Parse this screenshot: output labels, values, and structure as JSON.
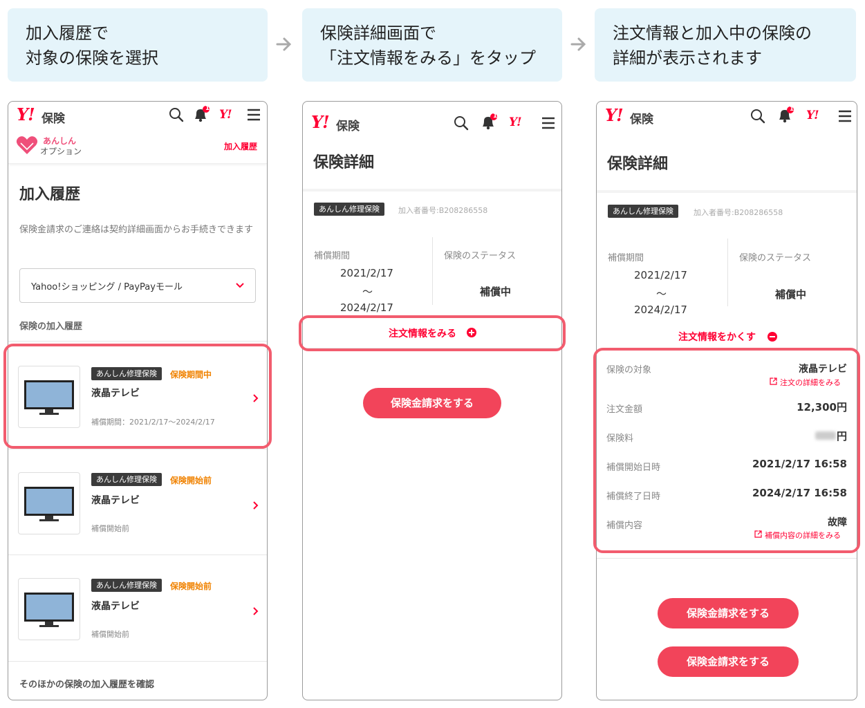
{
  "steps": [
    {
      "line1": "加入履歴で",
      "line2": "対象の保険を選択"
    },
    {
      "line1": "保険詳細画面で",
      "line2": "「注文情報をみる」をタップ"
    },
    {
      "line1": "注文情報と加入中の保険の",
      "line2": "詳細が表示されます"
    }
  ],
  "header": {
    "logo": "Y!",
    "logo_sub": "保険",
    "notification_count": "1",
    "yahoo_mark": "Y!"
  },
  "screen1": {
    "brand_line1": "あんしん",
    "brand_line2": "オプション",
    "history_link": "加入履歴",
    "title": "加入履歴",
    "description": "保険金請求のご連絡は契約詳細画面からお手続きできます",
    "select_value": "Yahoo!ショッピング / PayPayモール",
    "section_label": "保険の加入履歴",
    "items": [
      {
        "badge": "あんしん修理保険",
        "status": "保険期間中",
        "name": "液晶テレビ",
        "sub": "補償期間：2021/2/17〜2024/2/17"
      },
      {
        "badge": "あんしん修理保険",
        "status": "保険開始前",
        "name": "液晶テレビ",
        "sub": "補償開始前"
      },
      {
        "badge": "あんしん修理保険",
        "status": "保険開始前",
        "name": "液晶テレビ",
        "sub": "補償開始前"
      }
    ],
    "footer_link": "そのほかの保険の加入履歴を確認"
  },
  "screen2": {
    "title": "保険詳細",
    "badge": "あんしん修理保険",
    "member_no": "加入者番号:B208286558",
    "period_label": "補償期間",
    "period_start": "2021/2/17",
    "period_tilde": "〜",
    "period_end": "2024/2/17",
    "status_label": "保険のステータス",
    "status_value": "補償中",
    "toggle_link": "注文情報をみる",
    "claim_button": "保険金請求をする"
  },
  "screen3": {
    "title": "保険詳細",
    "badge": "あんしん修理保険",
    "member_no": "加入者番号:B208286558",
    "period_label": "補償期間",
    "period_start": "2021/2/17",
    "period_tilde": "〜",
    "period_end": "2024/2/17",
    "status_label": "保険のステータス",
    "status_value": "補償中",
    "toggle_link": "注文情報をかくす",
    "rows": [
      {
        "label": "保険の対象",
        "value": "液晶テレビ",
        "link": "注文の詳細をみる"
      },
      {
        "label": "注文金額",
        "value": "12,300円"
      },
      {
        "label": "保険料",
        "value": "円"
      },
      {
        "label": "補償開始日時",
        "value": "2021/2/17 16:58"
      },
      {
        "label": "補償終了日時",
        "value": "2024/2/17 16:58"
      },
      {
        "label": "補償内容",
        "value": "故障",
        "link": "補償内容の詳細をみる"
      }
    ],
    "claim_button_1": "保険金請求をする",
    "claim_button_2": "保険金請求をする"
  },
  "colors": {
    "brand_red": "#ff0033",
    "highlight": "#f25c6e",
    "step_bg": "#e5f4fa",
    "status_orange": "#f08200",
    "button_pink": "#f2445a"
  }
}
